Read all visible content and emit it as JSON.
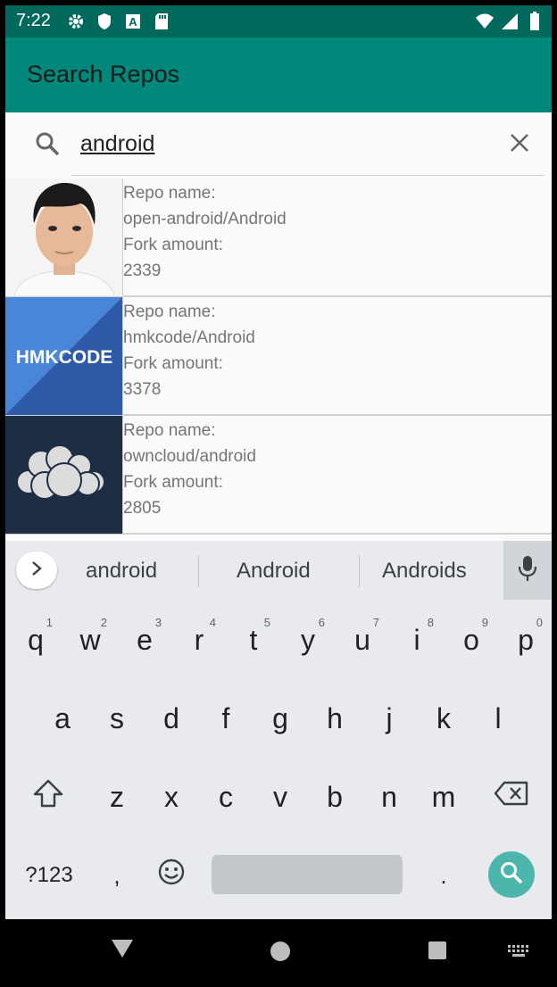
{
  "status_bar": {
    "time": "7:22",
    "left_icons": [
      "settings-icon",
      "shield-icon",
      "font-a-icon",
      "sd-card-icon"
    ],
    "right_icons": [
      "wifi-icon",
      "signal-icon",
      "battery-icon"
    ]
  },
  "app_bar": {
    "title": "Search Repos",
    "color": "#00897b"
  },
  "search": {
    "query": "android",
    "search_icon": "search-icon",
    "clear_icon": "close-icon"
  },
  "repos": [
    {
      "name_label": "Repo name:",
      "name": "open-android/Android",
      "fork_label": "Fork amount:",
      "forks": "2339",
      "avatar": "photo-avatar"
    },
    {
      "name_label": "Repo name:",
      "name": "hmkcode/Android",
      "fork_label": "Fork amount:",
      "forks": "3378",
      "avatar": "hmkcode-logo",
      "avatar_text": "HMKCODE"
    },
    {
      "name_label": "Repo name:",
      "name": "owncloud/android",
      "fork_label": "Fork amount:",
      "forks": "2805",
      "avatar": "owncloud-logo"
    }
  ],
  "keyboard": {
    "suggestions": [
      "android",
      "Android",
      "Androids"
    ],
    "row1": [
      "q",
      "w",
      "e",
      "r",
      "t",
      "y",
      "u",
      "i",
      "o",
      "p"
    ],
    "row1_hints": [
      "1",
      "2",
      "3",
      "4",
      "5",
      "6",
      "7",
      "8",
      "9",
      "0"
    ],
    "row2": [
      "a",
      "s",
      "d",
      "f",
      "g",
      "h",
      "j",
      "k",
      "l"
    ],
    "row3": [
      "z",
      "x",
      "c",
      "v",
      "b",
      "n",
      "m"
    ],
    "symbols_label": "?123",
    "comma": ",",
    "period": ".",
    "action_color": "#4db6ac"
  }
}
